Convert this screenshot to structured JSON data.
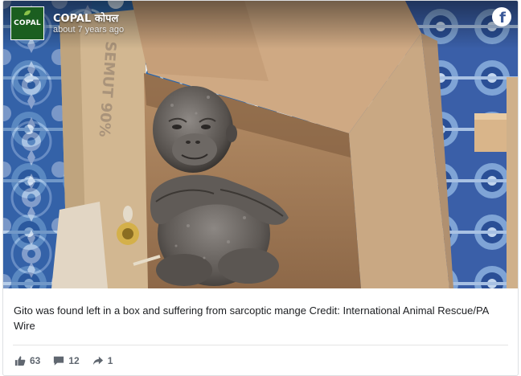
{
  "post": {
    "page_name": "COPAL कोपल",
    "timestamp": "about 7 years ago",
    "logo_text": "COPAL",
    "caption": "Gito was found left in a box and suffering from sarcoptic mange Credit: International Animal Rescue/PA Wire",
    "box_print": "SEMUT 90%"
  },
  "actions": {
    "likes": "63",
    "comments": "12",
    "shares": "1"
  },
  "icons": {
    "platform": "facebook-icon",
    "like": "thumbs-up-icon",
    "comment": "comment-icon",
    "share": "share-arrow-icon"
  },
  "colors": {
    "facebook_blue": "#3b5998",
    "logo_green": "#1b5e20",
    "caption_text": "#1c1e21",
    "meta_text": "#606770"
  }
}
